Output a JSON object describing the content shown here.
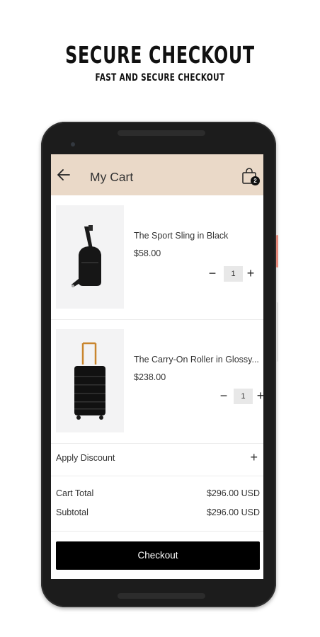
{
  "promo": {
    "title": "SECURE CHECKOUT",
    "subtitle": "FAST AND SECURE CHECKOUT"
  },
  "appbar": {
    "title": "My Cart",
    "back_icon": "arrow-left-icon",
    "bag_icon": "shopping-bag-icon",
    "bag_badge": "2",
    "background": "#ead9c8"
  },
  "cart": {
    "items": [
      {
        "name": "The Sport Sling in Black",
        "price": "$58.00",
        "quantity": "1",
        "minus": "−",
        "plus": "+"
      },
      {
        "name": "The Carry-On Roller in Glossy...",
        "price": "$238.00",
        "quantity": "1",
        "minus": "−",
        "plus": "+"
      }
    ]
  },
  "discount": {
    "label": "Apply Discount",
    "plus": "+"
  },
  "totals": {
    "cart_total_label": "Cart Total",
    "cart_total_value": "$296.00 USD",
    "subtotal_label": "Subtotal",
    "subtotal_value": "$296.00 USD"
  },
  "checkout": {
    "label": "Checkout"
  }
}
